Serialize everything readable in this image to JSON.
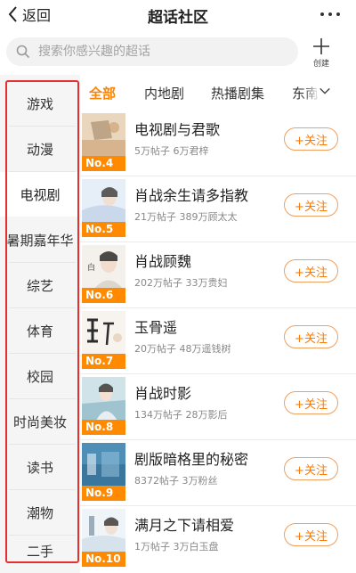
{
  "header": {
    "back_label": "返回",
    "title": "超话社区",
    "more_icon": "more-horizontal-icon"
  },
  "search": {
    "placeholder": "搜索你感兴趣的超话",
    "create_label": "创建"
  },
  "sidebar": {
    "active_index": 2,
    "items": [
      {
        "label": "游戏"
      },
      {
        "label": "动漫"
      },
      {
        "label": "电视剧"
      },
      {
        "label": "暑期嘉年华"
      },
      {
        "label": "综艺"
      },
      {
        "label": "体育"
      },
      {
        "label": "校园"
      },
      {
        "label": "时尚美妆"
      },
      {
        "label": "读书"
      },
      {
        "label": "潮物"
      },
      {
        "label": "二手"
      }
    ]
  },
  "tabs": {
    "active_index": 0,
    "items": [
      {
        "label": "全部"
      },
      {
        "label": "内地剧"
      },
      {
        "label": "热播剧集"
      },
      {
        "label": "东南"
      }
    ]
  },
  "list": [
    {
      "rank": "No.4",
      "title": "电视剧与君歌",
      "meta": "5万帖子 6万君梓",
      "follow": "+关注"
    },
    {
      "rank": "No.5",
      "title": "肖战余生请多指教",
      "meta": "21万帖子 389万顾太太",
      "follow": "+关注"
    },
    {
      "rank": "No.6",
      "title": "肖战顾魏",
      "meta": "202万帖子 33万贵妇",
      "follow": "+关注"
    },
    {
      "rank": "No.7",
      "title": "玉骨遥",
      "meta": "20万帖子 48万遥钱树",
      "follow": "+关注"
    },
    {
      "rank": "No.8",
      "title": "肖战时影",
      "meta": "134万帖子 28万影后",
      "follow": "+关注"
    },
    {
      "rank": "No.9",
      "title": "剧版暗格里的秘密",
      "meta": "8372帖子 3万粉丝",
      "follow": "+关注"
    },
    {
      "rank": "No.10",
      "title": "满月之下请相爱",
      "meta": "1万帖子 3万白玉盘",
      "follow": "+关注"
    }
  ],
  "colors": {
    "accent": "#ff8200",
    "highlight_border": "#e5302f",
    "rank_badge": "#ff8a00"
  }
}
